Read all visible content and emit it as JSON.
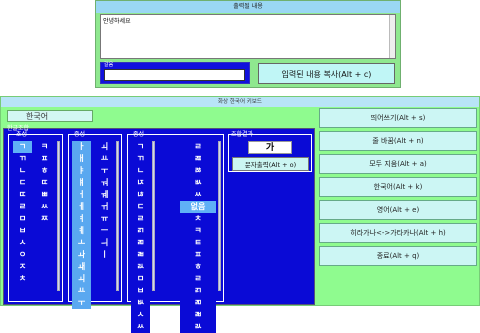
{
  "output_window": {
    "title": "출력될 내용",
    "text": "안녕하세요",
    "count_legend": "갈음",
    "copy_button": "입력된 내용 복사(Alt + c)"
  },
  "keyboard": {
    "title": "화상 한국어 키보드",
    "mode_button": "한국어",
    "panel_legend": "한글조합",
    "cho_legend": "초성",
    "jung_legend": "중성",
    "jong_legend": "종성",
    "result_legend": "조합결과",
    "result_char": "가",
    "print_button": "문자출력(Alt + o)",
    "cho_left": [
      "ㄱ",
      "ㄲ",
      "ㄴ",
      "ㄷ",
      "ㄸ",
      "ㄹ",
      "ㅁ",
      "ㅂ",
      "ㅅ",
      "ㅇ",
      "ㅈ",
      "ㅊ"
    ],
    "cho_right": [
      "ㅋ",
      "ㅍ",
      "ㅎ",
      "ㄸ",
      "ㅃ",
      "ㅆ",
      "ㅉ"
    ],
    "jung_left": [
      "ㅏ",
      "ㅐ",
      "ㅑ",
      "ㅒ",
      "ㅓ",
      "ㅔ",
      "ㅕ",
      "ㅖ",
      "ㅗ",
      "ㅘ",
      "ㅙ",
      "ㅚ",
      "ㅛ",
      "ㅜ"
    ],
    "jung_right": [
      "ㅚ",
      "ㅛ",
      "ㅜ",
      "ㅝ",
      "ㅞ",
      "ㅟ",
      "ㅠ",
      "ㅡ",
      "ㅢ",
      "ㅣ"
    ],
    "jong_left": [
      "ㄱ",
      "ㄲ",
      "ㄴ",
      "ㄵ",
      "ㄶ",
      "ㄷ",
      "ㄹ",
      "ㄺ",
      "ㄻ",
      "ㄼ",
      "ㄽ",
      "ㅁ",
      "ㅂ",
      "ㅄ",
      "ㅅ",
      "ㅆ"
    ],
    "jong_right": [
      "ㄹ",
      "ㄿ",
      "ㅀ",
      "ㅄ",
      "ㅆ",
      "없음",
      "ㅊ",
      "ㅋ",
      "ㅌ",
      "ㅍ",
      "ㅎ",
      "ㄹ",
      "ㄺ",
      "ㄻ",
      "ㄼ",
      "ㄽ"
    ],
    "cho_selected": "ㄱ",
    "jong_selected_right": "없음",
    "functions": [
      "띄어쓰기(Alt + s)",
      "줄 바꿈(Alt + n)",
      "모두 지움(Alt + a)",
      "한국어(Alt + k)",
      "영어(Alt + e)",
      "히라가나<->가타카나(Alt + h)",
      "종료(Alt + q)"
    ]
  }
}
